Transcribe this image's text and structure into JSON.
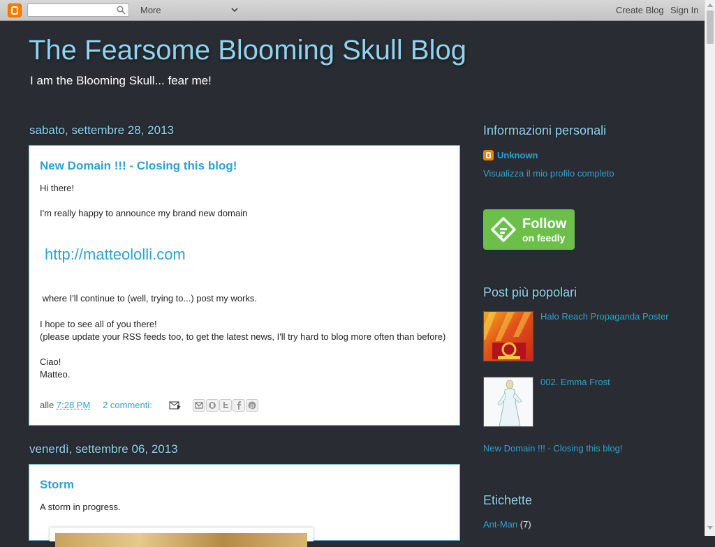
{
  "navbar": {
    "search_placeholder": "",
    "more_label": "More",
    "create_blog": "Create Blog",
    "sign_in": "Sign In"
  },
  "header": {
    "title": "The Fearsome Blooming Skull Blog",
    "description": "I am the Blooming Skull... fear me!"
  },
  "posts": [
    {
      "date": "sabato, settembre 28, 2013",
      "title": "New Domain !!! - Closing this blog!",
      "lines": [
        "Hi there!",
        "I'm really happy to announce my brand new domain",
        " where I'll continue to (well, trying to...) post my works.",
        "I hope to see all of you there!",
        "(please update your RSS feeds too, to get the latest news, I'll try hard to blog more often than before)",
        "Ciao!",
        "Matteo."
      ],
      "link": "http://matteololli.com",
      "footer_prefix": "alle",
      "time": "7:28 PM",
      "comments": "2 commenti:"
    },
    {
      "date": "venerdì, settembre 06, 2013",
      "title": "Storm",
      "lines": [
        "A storm in progress."
      ]
    }
  ],
  "sidebar": {
    "profile": {
      "title": "Informazioni personali",
      "name": "Unknown",
      "full_profile": "Visualizza il mio profilo completo"
    },
    "feedly": {
      "line1": "Follow",
      "line2": "on feedly"
    },
    "popular": {
      "title": "Post più popolari",
      "items": [
        "Halo Reach Propaganda Poster",
        "002. Emma Frost",
        "New Domain !!! - Closing this blog!"
      ]
    },
    "labels": {
      "title": "Etichette",
      "items": [
        {
          "name": "Ant-Man",
          "count": "(7)"
        }
      ]
    }
  },
  "colors": {
    "background": "#292d33",
    "accent": "#2ca2d0",
    "title": "#8fd3ef",
    "blogger_orange": "#f57d00",
    "feedly_green": "#6cc04a"
  },
  "icons": [
    "blogger-logo-icon",
    "search-icon",
    "chevron-down-icon",
    "email-post-icon",
    "email-share-icon",
    "blogthis-icon",
    "twitter-icon",
    "facebook-icon",
    "pinterest-icon",
    "feedly-icon"
  ]
}
